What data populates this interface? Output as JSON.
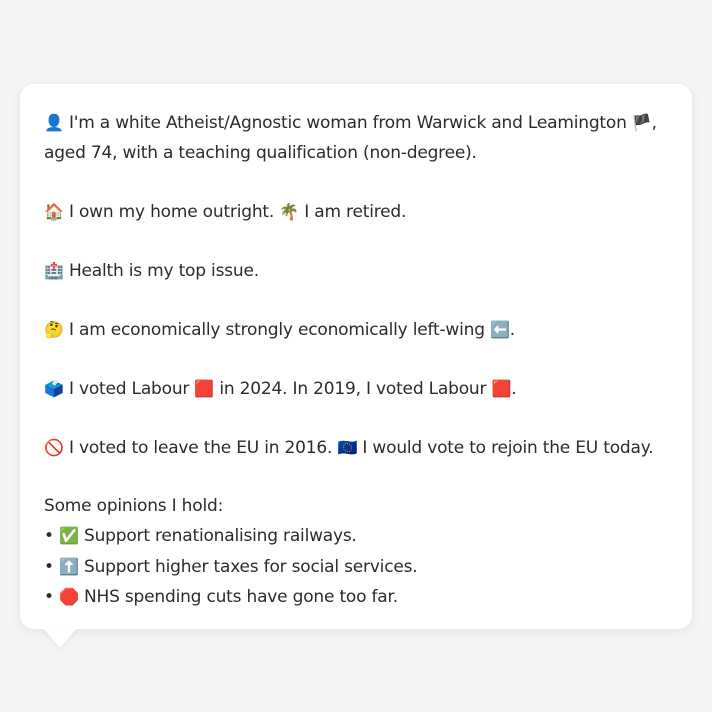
{
  "bio": {
    "icon": "👤",
    "text": "I'm a white Atheist/Agnostic woman from Warwick and Leamington",
    "flag": "🏴",
    "continuation": "aged 74, with a teaching qualification (non-degree)."
  },
  "home": {
    "icon": "🏠",
    "text": "I own my home outright.",
    "retired_icon": "🌴",
    "retired_text": "I am retired."
  },
  "issue": {
    "icon": "🏥",
    "text": "Health is my top issue."
  },
  "economics": {
    "icon": "🤔",
    "text": "I am economically strongly economically left-wing",
    "arrow_icon": "⬅️"
  },
  "votes": {
    "icon": "🗳️",
    "text_2024": "I voted Labour",
    "party_2024_icon": "🟥",
    "text_2019": "in 2024. In 2019, I voted Labour",
    "party_2019_icon": "🟥"
  },
  "eu": {
    "icon": "🚫",
    "text": "I voted to leave the EU in 2016.",
    "eu_icon": "🇪🇺",
    "rejoin_text": "I would vote to rejoin the EU today."
  },
  "opinions": {
    "heading": "Some opinions I hold:",
    "items": [
      {
        "bullet": "•",
        "icon": "✅",
        "text": "Support renationalising railways."
      },
      {
        "bullet": "•",
        "icon": "⬆️",
        "text": "Support higher taxes for social services."
      },
      {
        "bullet": "•",
        "icon": "🛑",
        "text": "NHS spending cuts have gone too far."
      }
    ]
  },
  "colors": {
    "background": "#f3f4f6",
    "card": "#ffffff",
    "text": "#2b2b2b"
  }
}
